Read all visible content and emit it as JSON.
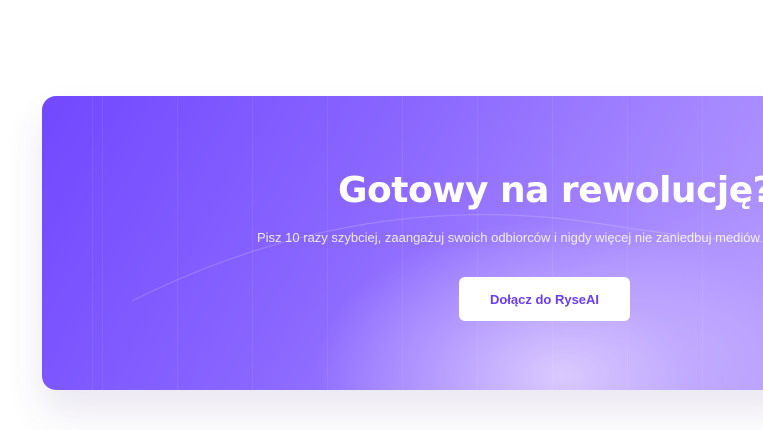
{
  "cta": {
    "heading": "Gotowy na rewolucję?",
    "subtext": "Pisz 10 razy szybciej, zaangażuj swoich odbiorców i nigdy więcej nie zaniedbuj mediów",
    "button_label": "Dołącz do RyseAI"
  },
  "colors": {
    "gradient_start": "#7248ff",
    "gradient_end": "#b69cff",
    "glow": "#dccdff",
    "button_background": "#ffffff",
    "button_text": "#6a3df5",
    "heading_text": "#ffffff"
  }
}
